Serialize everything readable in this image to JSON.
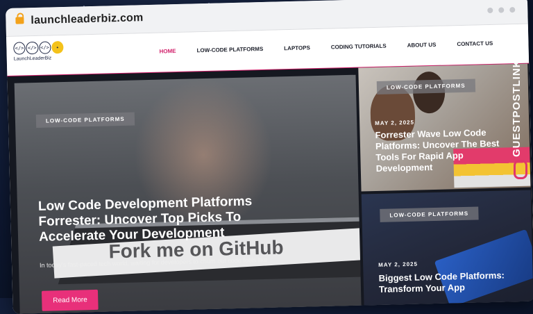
{
  "browser": {
    "url": "launchleaderbiz.com"
  },
  "site": {
    "logo_text": "LaunchLeaderBiz",
    "logo_glyphs": [
      "</>",
      "</>",
      "</>",
      "✦"
    ],
    "nav": [
      "HOME",
      "LOW-CODE PLATFORMS",
      "LAPTOPS",
      "CODING TUTORIALS",
      "ABOUT US",
      "CONTACT US"
    ],
    "active_nav": "HOME"
  },
  "hero": {
    "tag": "LOW-CODE PLATFORMS",
    "title": "Low Code Development Platforms Forrester: Uncover Top Picks To Accelerate Your Development",
    "image_text": "Fork me on GitHub",
    "excerpt": "In today's fast-paced tech world, waiting for developers to churn out code feels like",
    "button": "Read More"
  },
  "cards": [
    {
      "tag": "LOW-CODE PLATFORMS",
      "date": "MAY 2, 2025",
      "title": "Forrester Wave Low Code Platforms: Uncover The Best Tools For Rapid App Development"
    },
    {
      "tag": "LOW-CODE PLATFORMS",
      "date": "MAY 2, 2025",
      "title": "Biggest Low Code Platforms: Transform Your App"
    }
  ],
  "side_badge": "GUESTPOSTLINKS",
  "colors": {
    "accent": "#d11f6a",
    "button": "#e8307a",
    "logo_yellow": "#f4c21b",
    "lock": "#f3a21b",
    "background": "#0d1730"
  }
}
